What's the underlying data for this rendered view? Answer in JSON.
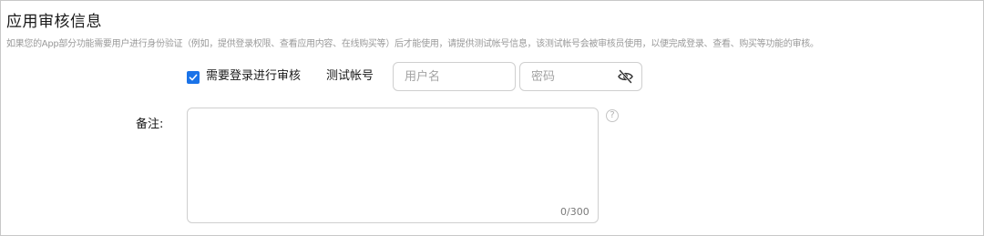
{
  "section": {
    "title": "应用审核信息",
    "description": "如果您的App部分功能需要用户进行身份验证（例如，提供登录权限、查看应用内容、在线购买等）后才能使用，请提供测试帐号信息，该测试帐号会被审核员使用，以便完成登录、查看、购买等功能的审核。"
  },
  "login_review": {
    "checkbox_label": "需要登录进行审核",
    "checked": true,
    "test_account_label": "测试帐号",
    "username_placeholder": "用户名",
    "username_value": "",
    "password_placeholder": "密码",
    "password_value": "",
    "password_visibility_icon": "eye-off-icon"
  },
  "remarks": {
    "label": "备注:",
    "value": "",
    "counter": "0/300",
    "help_icon": "question-circle-icon",
    "help_glyph": "?"
  },
  "colors": {
    "accent": "#1a73e8",
    "border": "#cfcfcf",
    "muted_text": "#9a9a9a"
  }
}
